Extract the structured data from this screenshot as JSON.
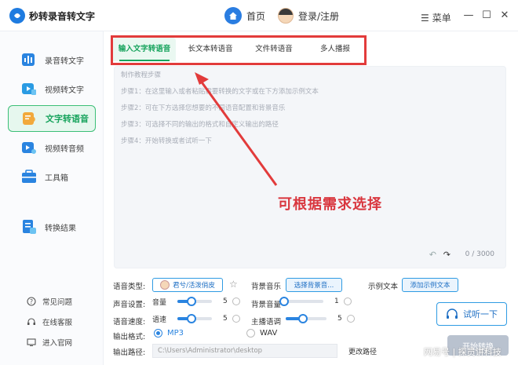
{
  "app": {
    "title": "秒转录音转文字"
  },
  "header": {
    "home_label": "首页",
    "login_label": "登录/注册",
    "menu_label": "菜单",
    "min_glyph": "—",
    "max_glyph": "☐",
    "close_glyph": "✕"
  },
  "sidebar": {
    "items": [
      {
        "label": "录音转文字",
        "icon": "audio-wave-icon"
      },
      {
        "label": "视频转文字",
        "icon": "video-text-icon"
      },
      {
        "label": "文字转语音",
        "icon": "text-speech-icon",
        "active": true
      },
      {
        "label": "视频转音频",
        "icon": "video-audio-icon"
      },
      {
        "label": "工具箱",
        "icon": "toolbox-icon"
      },
      {
        "label": "转换结果",
        "icon": "result-icon"
      }
    ],
    "bottom": [
      {
        "label": "常见问题"
      },
      {
        "label": "在线客服"
      },
      {
        "label": "进入官网"
      }
    ]
  },
  "tabs": [
    {
      "label": "输入文字转语音",
      "active": true
    },
    {
      "label": "长文本转语音"
    },
    {
      "label": "文件转语音"
    },
    {
      "label": "多人播报"
    }
  ],
  "editor": {
    "lines": [
      "制作教程步骤",
      "步骤1：在这里输入或者粘贴需要转换的文字或在下方添加示例文本",
      "步骤2：可在下方选择您想要的不同语音配置和背景音乐",
      "步骤3：可选择不同的输出的格式和自定义输出的路径",
      "步骤4：开始转换或者试听一下"
    ],
    "counter": "0 / 3000"
  },
  "annotation": "可根据需求选择",
  "settings": {
    "voice_type_label": "语音类型:",
    "voice_name": "君兮/活泼俏皮",
    "bgm_label": "背景音乐",
    "bgm_button": "选择背景音...",
    "example_label": "示例文本",
    "example_button": "添加示例文本",
    "sound_label": "声音设置:",
    "volume_label": "音量",
    "volume_value": "5",
    "bgm_volume_label": "背景音量",
    "bgm_volume_value": "1",
    "speed_label": "语音速度:",
    "speed_sub_label": "语速",
    "speed_value": "5",
    "pitch_label": "主播语调",
    "pitch_value": "5",
    "format_label": "输出格式:",
    "format_mp3": "MP3",
    "format_wav": "WAV",
    "path_label": "输出路径:",
    "path_value": "C:\\Users\\Administrator\\desktop",
    "change_path": "更改路径"
  },
  "actions": {
    "listen": "试听一下",
    "start": "开始转换"
  },
  "watermark": "网易号 | 探员讲科技",
  "colors": {
    "accent_green": "#16a35c",
    "accent_blue": "#2a84e0",
    "annotation_red": "#e23b3b"
  }
}
